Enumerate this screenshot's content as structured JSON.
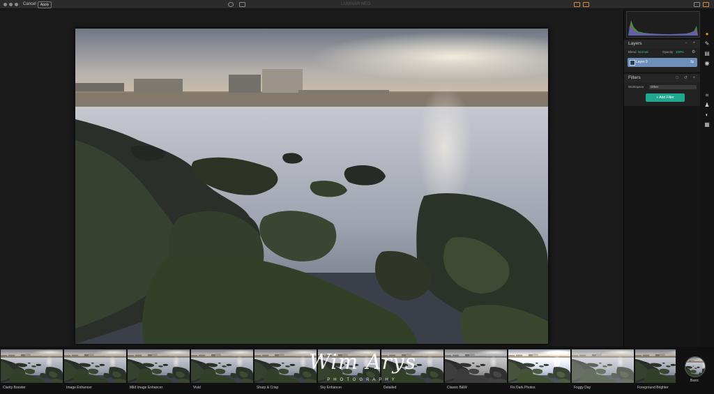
{
  "titlebar": {
    "cancel_label": "Cancel",
    "apply_label": "Apply",
    "doc_title": "LUMINAR NEO"
  },
  "layers": {
    "title": "Layers",
    "blend_label": "Blend",
    "blend_value": "Normal",
    "opacity_label": "Opacity",
    "opacity_value": "100%",
    "layer_name": "Layer 0"
  },
  "filters": {
    "title": "Filters",
    "workspace_label": "Workspace",
    "workspace_value": "Other",
    "add_filter_label": "+ Add Filter"
  },
  "presets": [
    {
      "label": "Clarity Booster"
    },
    {
      "label": "Image Enhancer"
    },
    {
      "label": "Mild Image Enhancer"
    },
    {
      "label": "Vivid"
    },
    {
      "label": "Sharp & Crisp"
    },
    {
      "label": "Sky Enhancer"
    },
    {
      "label": "Detailed"
    },
    {
      "label": "Classic B&W"
    },
    {
      "label": "Fix Dark Photos"
    },
    {
      "label": "Foggy Day"
    },
    {
      "label": "Foreground Brighter"
    }
  ],
  "basic_label": "Basic",
  "watermark": {
    "name": "Wim Arys",
    "subtitle": "PHOTOGRAPHY"
  },
  "colors": {
    "accent": "#1fa88f",
    "layer_selected": "#6e8fb9",
    "tool_orange": "#e08a2c"
  },
  "icons": [
    "close-dot-icon",
    "minimize-dot-icon",
    "zoom-dot-icon",
    "eye-icon",
    "compare-icon",
    "brush-icon",
    "settings-icon",
    "crop-icon",
    "stamp-icon",
    "erase-icon",
    "layers-icon"
  ]
}
